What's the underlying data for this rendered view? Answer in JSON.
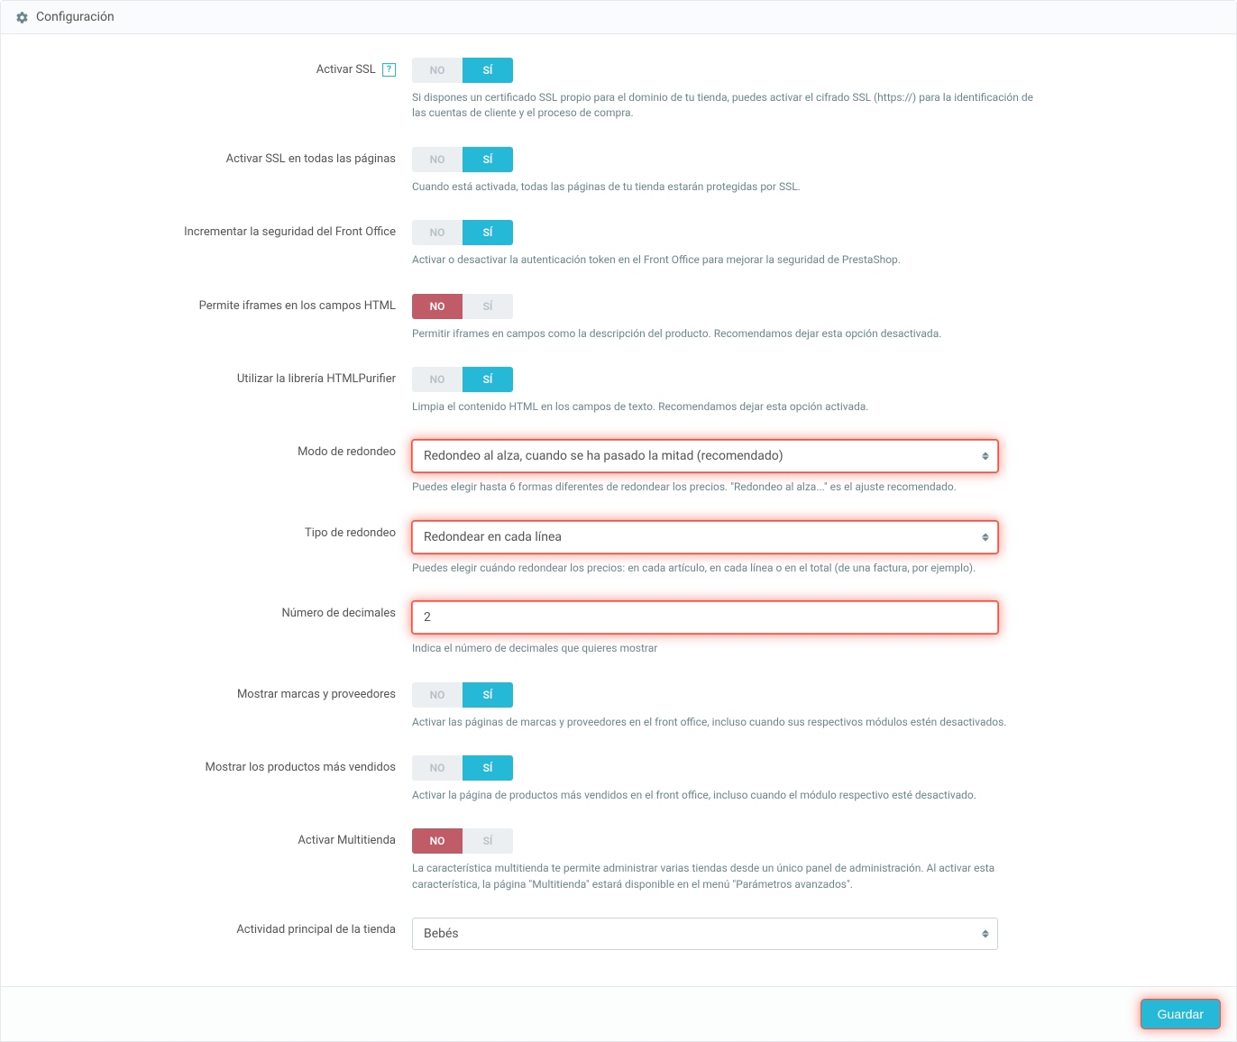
{
  "heading": "Configuración",
  "fields": {
    "ssl": {
      "label": "Activar SSL",
      "no": "NO",
      "yes": "SÍ",
      "value": "yes",
      "help": "Si dispones un certificado SSL propio para el dominio de tu tienda, puedes activar el cifrado SSL (https://) para la identificación de las cuentas de cliente y el proceso de compra."
    },
    "ssl_all": {
      "label": "Activar SSL en todas las páginas",
      "no": "NO",
      "yes": "SÍ",
      "value": "yes",
      "help": "Cuando está activada, todas las páginas de tu tienda estarán protegidas por SSL."
    },
    "fo_security": {
      "label": "Incrementar la seguridad del Front Office",
      "no": "NO",
      "yes": "SÍ",
      "value": "yes",
      "help": "Activar o desactivar la autenticación token en el Front Office para mejorar la seguridad de PrestaShop."
    },
    "iframes": {
      "label": "Permite iframes en los campos HTML",
      "no": "NO",
      "yes": "SÍ",
      "value": "no",
      "help": "Permitir iframes en campos como la descripción del producto. Recomendamos dejar esta opción desactivada."
    },
    "purifier": {
      "label": "Utilizar la librería HTMLPurifier",
      "no": "NO",
      "yes": "SÍ",
      "value": "yes",
      "help": "Limpia el contenido HTML en los campos de texto. Recomendamos dejar esta opción activada."
    },
    "round_mode": {
      "label": "Modo de redondeo",
      "value": "Redondeo al alza, cuando se ha pasado la mitad (recomendado)",
      "help": "Puedes elegir hasta 6 formas diferentes de redondear los precios. \"Redondeo al alza...\" es el ajuste recomendado."
    },
    "round_type": {
      "label": "Tipo de redondeo",
      "value": "Redondear en cada línea",
      "help": "Puedes elegir cuándo redondear los precios: en cada artículo, en cada línea o en el total (de una factura, por ejemplo)."
    },
    "decimals": {
      "label": "Número de decimales",
      "value": "2",
      "help": "Indica el número de decimales que quieres mostrar"
    },
    "brands": {
      "label": "Mostrar marcas y proveedores",
      "no": "NO",
      "yes": "SÍ",
      "value": "yes",
      "help": "Activar las páginas de marcas y proveedores en el front office, incluso cuando sus respectivos módulos estén desactivados."
    },
    "best_sellers": {
      "label": "Mostrar los productos más vendidos",
      "no": "NO",
      "yes": "SÍ",
      "value": "yes",
      "help": "Activar la página de productos más vendidos en el front office, incluso cuando el módulo respectivo esté desactivado."
    },
    "multistore": {
      "label": "Activar Multitienda",
      "no": "NO",
      "yes": "SÍ",
      "value": "no",
      "help": "La característica multitienda te permite administrar varias tiendas desde un único panel de administración. Al activar esta característica, la página \"Multitienda\" estará disponible en el menú \"Parámetros avanzados\"."
    },
    "activity": {
      "label": "Actividad principal de la tienda",
      "value": "Bebés"
    }
  },
  "save_label": "Guardar",
  "help_q": "?"
}
